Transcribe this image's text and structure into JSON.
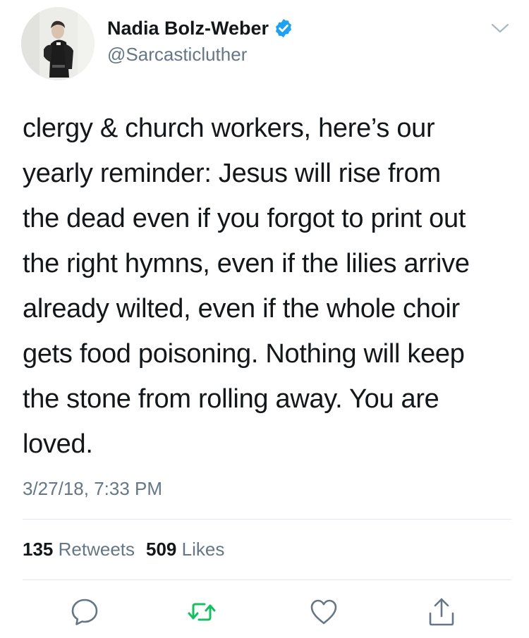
{
  "author": {
    "display_name": "Nadia Bolz-Weber",
    "handle": "@Sarcasticluther",
    "verified": true,
    "avatar": "profile-photo"
  },
  "tweet": {
    "text": "clergy & church workers, here’s our\nyearly reminder: Jesus will rise from\nthe dead even if you forgot to print out\nthe right hymns, even if the lilies arrive\nalready wilted, even if the whole choir\ngets food poisoning. Nothing will keep\nthe stone from rolling away. You are\nloved.",
    "timestamp": "3/27/18, 7:33 PM"
  },
  "stats": {
    "retweets_count": "135",
    "retweets_label": "Retweets",
    "likes_count": "509",
    "likes_label": "Likes"
  },
  "actions": [
    "reply-icon",
    "retweet-icon",
    "like-icon",
    "share-icon"
  ],
  "colors": {
    "text": "#14171a",
    "secondary": "#657786",
    "verified": "#1da1f2",
    "retweet_green": "#17bf63",
    "divider": "#e1e8ed"
  }
}
